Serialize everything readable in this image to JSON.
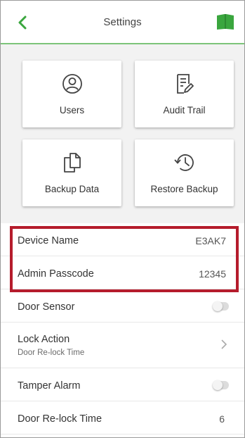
{
  "header": {
    "title": "Settings",
    "back_icon": "chevron-left-icon",
    "book_icon": "book-icon",
    "accent_color": "#3aa63e"
  },
  "cards": [
    {
      "label": "Users",
      "icon": "user-circle-icon"
    },
    {
      "label": "Audit Trail",
      "icon": "document-edit-icon"
    },
    {
      "label": "Backup Data",
      "icon": "copy-documents-icon"
    },
    {
      "label": "Restore Backup",
      "icon": "history-clock-icon"
    }
  ],
  "settings": {
    "device_name": {
      "label": "Device Name",
      "value": "E3AK7"
    },
    "admin_passcode": {
      "label": "Admin Passcode",
      "value": "12345"
    },
    "door_sensor": {
      "label": "Door Sensor",
      "enabled": false
    },
    "lock_action": {
      "label": "Lock Action",
      "sublabel": "Door Re-lock Time"
    },
    "tamper_alarm": {
      "label": "Tamper Alarm",
      "enabled": false
    },
    "door_relock_time": {
      "label": "Door Re-lock Time",
      "value": "6"
    }
  },
  "highlight_color": "#b51c2c"
}
